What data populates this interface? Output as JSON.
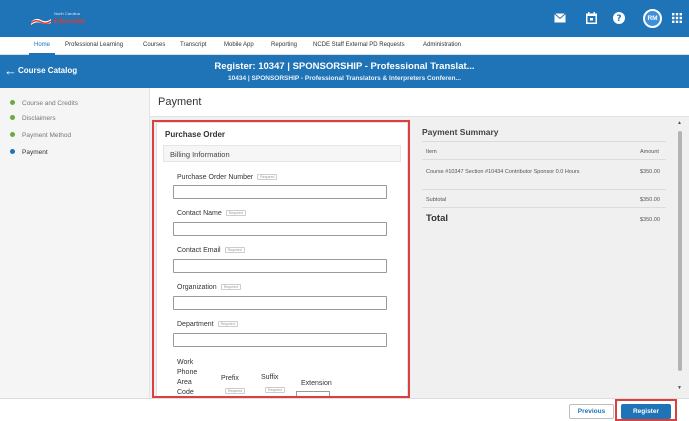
{
  "header": {
    "logo_top": "North Carolina",
    "logo_main": "Education",
    "icons": [
      "mail-icon",
      "calendar-icon",
      "help-icon",
      "grid-icon"
    ],
    "avatar_initials": "RM"
  },
  "nav": {
    "items": [
      "Home",
      "Professional Learning",
      "Courses",
      "Transcript",
      "Mobile App",
      "Reporting",
      "NCDE Staff External PD Requests",
      "Administration"
    ],
    "active": "Home"
  },
  "band": {
    "section": "Course Catalog",
    "title": "Register: 10347 | SPONSORSHIP - Professional Translat...",
    "subtitle": "10434 | SPONSORSHIP - Professional Translators & Interpreters Conferen..."
  },
  "steps": [
    {
      "label": "Course and Credits",
      "status": "complete"
    },
    {
      "label": "Disclaimers",
      "status": "complete"
    },
    {
      "label": "Payment Method",
      "status": "complete"
    },
    {
      "label": "Payment",
      "status": "current"
    }
  ],
  "page_title": "Payment",
  "purchase_order": {
    "title": "Purchase Order",
    "section": "Billing Information",
    "required_tag": "Required",
    "fields": [
      {
        "label": "Purchase Order Number",
        "value": ""
      },
      {
        "label": "Contact Name",
        "value": ""
      },
      {
        "label": "Contact Email",
        "value": ""
      },
      {
        "label": "Organization",
        "value": ""
      },
      {
        "label": "Department",
        "value": ""
      }
    ],
    "phone": {
      "area_label": "Work Phone Area Code",
      "prefix_label": "Prefix",
      "suffix_label": "Suffix",
      "extension_label": "Extension"
    }
  },
  "summary": {
    "title": "Payment Summary",
    "col_item": "Item",
    "col_amount": "Amount",
    "line_item": "Course #10347 Section #10434 Contributor Sponsor 0.0 Hours",
    "line_amount": "$350.00",
    "subtotal_label": "Subtotal",
    "subtotal_amount": "$350.00",
    "total_label": "Total",
    "total_amount": "$350.00"
  },
  "footer": {
    "previous": "Previous",
    "register": "Register"
  },
  "colors": {
    "brand_blue": "#1f73b7",
    "step_complete": "#6cab3c",
    "highlight_red": "#d94141"
  }
}
